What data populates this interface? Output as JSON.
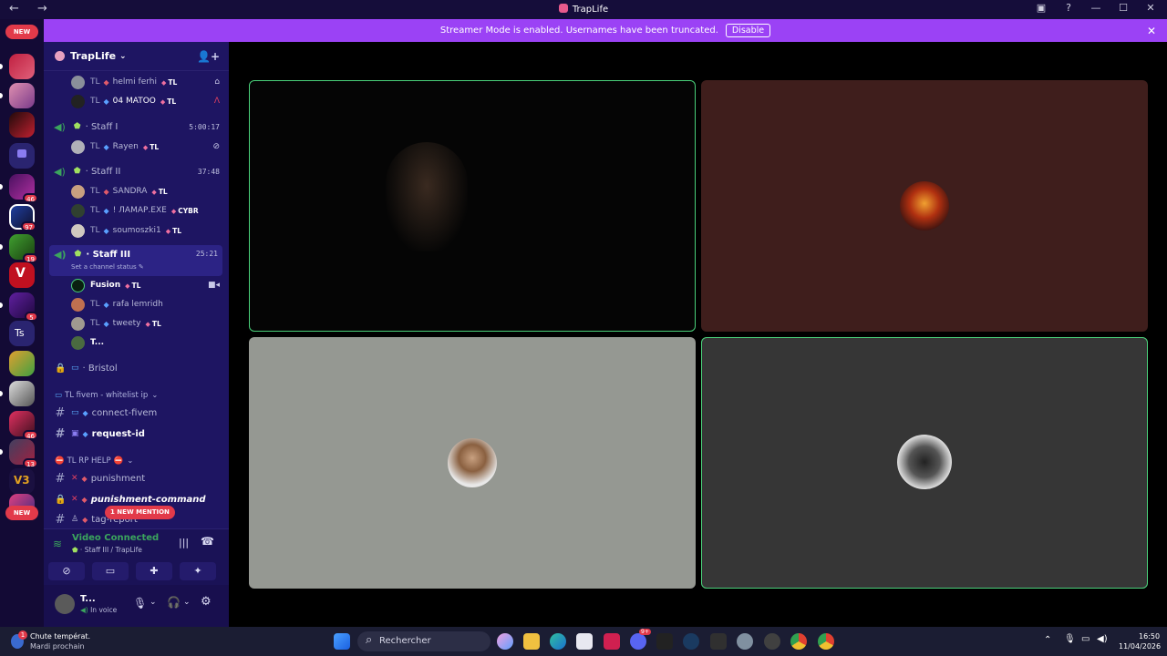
{
  "window": {
    "title": "TrapLife",
    "nav": "← →",
    "controls": [
      "▣",
      "?",
      "—",
      "☐",
      "✕"
    ]
  },
  "banner": {
    "text": "Streamer Mode is enabled. Usernames have been truncated.",
    "button": "Disable",
    "close": "✕"
  },
  "servers": {
    "new_top": "NEW",
    "new_bottom": "NEW",
    "ts_label": "Ts",
    "badges": [
      "46",
      "97",
      "19",
      "5",
      "46",
      "13"
    ]
  },
  "guild": {
    "name": "TrapLife",
    "chevron": "⌄",
    "invite_icon": "person-plus-icon"
  },
  "users_top": [
    {
      "prefix": "TL",
      "name": "helmi ferhi",
      "tag": "TL"
    },
    {
      "prefix": "TL",
      "name": "04 MATOO",
      "tag": "TL"
    }
  ],
  "staff1": {
    "name": "Staff I",
    "time": "5:00:17",
    "users": [
      {
        "prefix": "TL",
        "name": "Rayen",
        "tag": "TL"
      }
    ]
  },
  "staff2": {
    "name": "Staff II",
    "time": "37:48",
    "users": [
      {
        "prefix": "TL",
        "name": "SANDRA",
        "tag": "TL"
      },
      {
        "prefix": "TL",
        "name": "! ЛАМАР.EXE",
        "tag": "CYBR"
      },
      {
        "prefix": "TL",
        "name": "soumoszki1",
        "tag": "TL"
      }
    ]
  },
  "staff3": {
    "name": "Staff III",
    "time": "25:21",
    "status": "Set a channel status ✎",
    "users": [
      {
        "prefix": "",
        "name": "Fusion",
        "tag": "TL"
      },
      {
        "prefix": "TL",
        "name": "rafa lemridh",
        "tag": ""
      },
      {
        "prefix": "TL",
        "name": "tweety",
        "tag": "TL"
      },
      {
        "prefix": "",
        "name": "T...",
        "tag": ""
      }
    ]
  },
  "bristol": "Bristol",
  "cat_fivem": "TL fivem - whitelist ip",
  "ch_connect": "connect-fivem",
  "ch_request": "request-id",
  "cat_help": "TL RP HELP",
  "ch_punishment": "punishment",
  "ch_punishment_cmd": "punishment-command",
  "ch_tag": "tag-report",
  "new_mention": "1 NEW MENTION",
  "voice": {
    "status": "Video Connected",
    "channel": "Staff III / TrapLife"
  },
  "userbar": {
    "name": "T...",
    "status": "In voice"
  },
  "taskbar": {
    "weather_title": "Chute températ.",
    "weather_sub": "Mardi prochain",
    "search": "Rechercher",
    "time": "16:50",
    "date": "11/04/2026",
    "notif": "1",
    "discord_badge": "9+"
  },
  "colors": {
    "banner": "#9b42f5",
    "sidebar": "#1e1562",
    "speaking": "#4ad17a",
    "tile_brown": "#3f1e1c",
    "tile_gray": "#959892",
    "tile_dark": "#363636"
  }
}
